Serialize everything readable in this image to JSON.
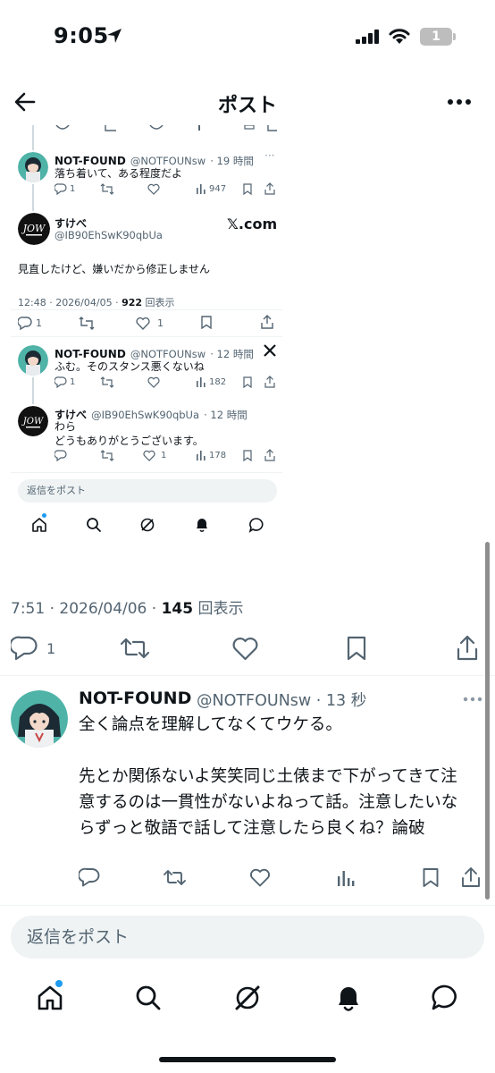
{
  "status_bar": {
    "time": "9:05",
    "battery": "1"
  },
  "header": {
    "title": "ポスト"
  },
  "embedded": {
    "reply1": {
      "name": "NOT-FOUND",
      "handle": "@NOTFOUNsw",
      "time": "· 19 時間",
      "text": "落ち着いて、ある程度だよ",
      "replies": "1",
      "views": "947"
    },
    "main": {
      "name": "すけべ",
      "handle": "@IB90EhSwK90qbUa",
      "watermark": "𝕏.com",
      "text": "見直したけど、嫌いだから修正しません",
      "timestamp": "12:48 · 2026/04/05 · ",
      "views_num": "922",
      "views_label": " 回表示",
      "replies": "1",
      "likes": "1"
    },
    "reply2": {
      "name": "NOT-FOUND",
      "handle": "@NOTFOUNsw",
      "time": "· 12 時間",
      "text": "ふむ。そのスタンス悪くないね",
      "replies": "1",
      "views": "182"
    },
    "reply3": {
      "name": "すけべ",
      "handle": "@IB90EhSwK90qbUa",
      "time": "· 12 時間",
      "text": "わら\nどうもありがとうございます。",
      "likes": "1",
      "views": "178"
    },
    "reply_placeholder": "返信をポスト"
  },
  "post_meta": {
    "timestamp": "7:51 · 2026/04/06 · ",
    "views_num": "145",
    "views_label": " 回表示",
    "replies": "1"
  },
  "reply_post": {
    "name": "NOT-FOUND",
    "handle": "@NOTFOUNsw · 13 秒",
    "body": "全く論点を理解してなくてウケる。\n\n先とか関係ないよ笑笑同じ土俵まで下がってきて注意するのは一貫性がないよねって話。注意したいならずっと敬語で話して注意したら良くね？論破"
  },
  "reply_bar": {
    "placeholder": "返信をポスト"
  },
  "colors": {
    "accent": "#1d9bf0",
    "text": "#0f1419",
    "muted": "#536471"
  }
}
